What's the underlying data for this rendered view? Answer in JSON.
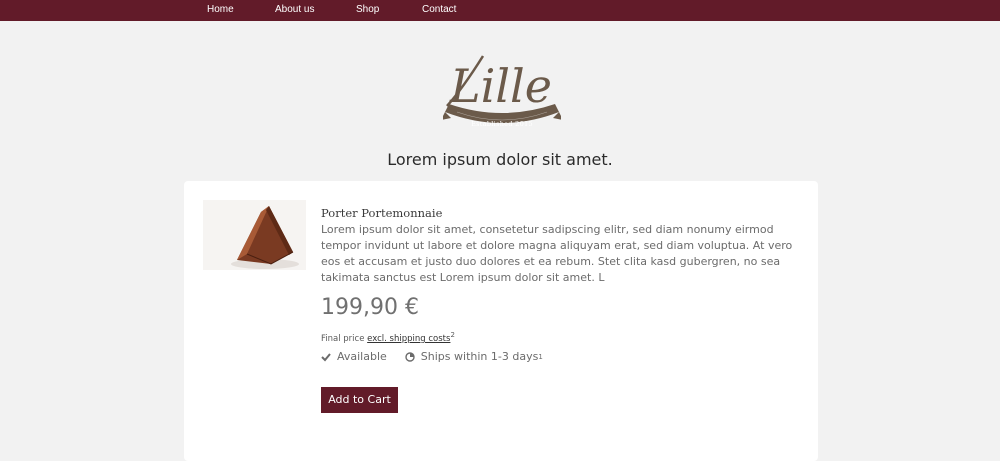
{
  "nav": {
    "items": [
      "Home",
      "About us",
      "Shop",
      "Contact"
    ]
  },
  "brand": {
    "logo_text": "Lille",
    "logo_subtext": "Established 2015"
  },
  "tagline": "Lorem ipsum dolor sit amet.",
  "product": {
    "name": "Porter Portemonnaie",
    "description": "Lorem ipsum dolor sit amet, consetetur sadipscing elitr, sed diam nonumy eirmod tempor invidunt ut labore et dolore magna aliquyam erat, sed diam voluptua. At vero eos et accusam et justo duo dolores et ea rebum. Stet clita kasd gubergren, no sea takimata sanctus est Lorem ipsum dolor sit amet. L",
    "price": "199,90 €",
    "price_note_prefix": "Final price",
    "price_note_link": "excl. shipping costs",
    "price_note_footnote": "2",
    "availability_label": "Available",
    "shipping_label": "Ships within 1-3 days",
    "shipping_footnote": "1",
    "add_to_cart": "Add to Cart"
  },
  "colors": {
    "brand": "#621b29",
    "logo": "#6b5a4a",
    "background": "#f2f2f2"
  },
  "icons": {
    "availability": "checkmark-icon",
    "shipping": "clock-icon"
  }
}
